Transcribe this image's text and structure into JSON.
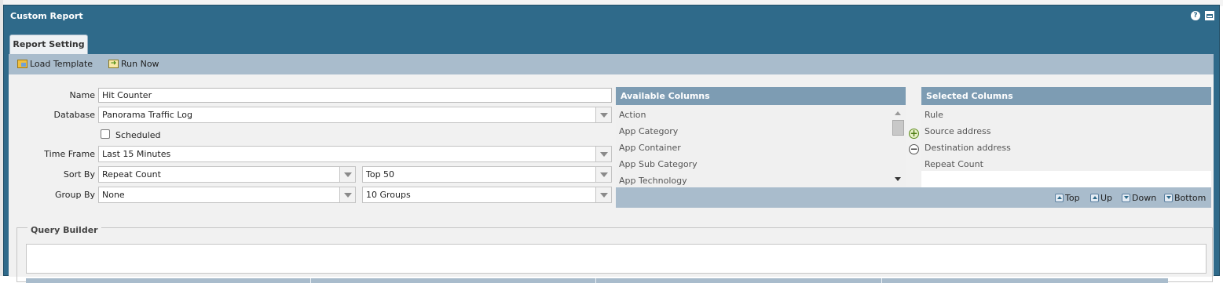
{
  "window": {
    "title": "Custom Report",
    "help_icon": "question-circle-icon",
    "maximize_icon": "maximize-icon"
  },
  "tabs": [
    {
      "label": "Report Setting"
    }
  ],
  "toolbar": {
    "load_template": {
      "label": "Load Template",
      "icon": "load-template-icon"
    },
    "run_now": {
      "label": "Run Now",
      "icon": "run-now-icon"
    }
  },
  "form": {
    "name": {
      "label": "Name",
      "value": "Hit Counter"
    },
    "database": {
      "label": "Database",
      "value": "Panorama Traffic Log"
    },
    "scheduled": {
      "label": "Scheduled",
      "checked": false
    },
    "time_frame": {
      "label": "Time Frame",
      "value": "Last 15 Minutes"
    },
    "sort_by": {
      "label": "Sort By",
      "value": "Repeat Count",
      "limit": "Top 50"
    },
    "group_by": {
      "label": "Group By",
      "value": "None",
      "limit": "10 Groups"
    }
  },
  "available_columns": {
    "header": "Available Columns",
    "items": [
      "Action",
      "App Category",
      "App Container",
      "App Sub Category",
      "App Technology"
    ]
  },
  "selected_columns": {
    "header": "Selected Columns",
    "items": [
      "Rule",
      "Source address",
      "Destination address",
      "Repeat Count"
    ],
    "buttons": {
      "top": "Top",
      "up": "Up",
      "down": "Down",
      "bottom": "Bottom"
    }
  },
  "query_builder": {
    "legend": "Query Builder",
    "value": ""
  },
  "colors": {
    "title_bar": "#2f6a8a",
    "toolbar": "#a9bccc",
    "panel_header": "#7d9cb3"
  }
}
